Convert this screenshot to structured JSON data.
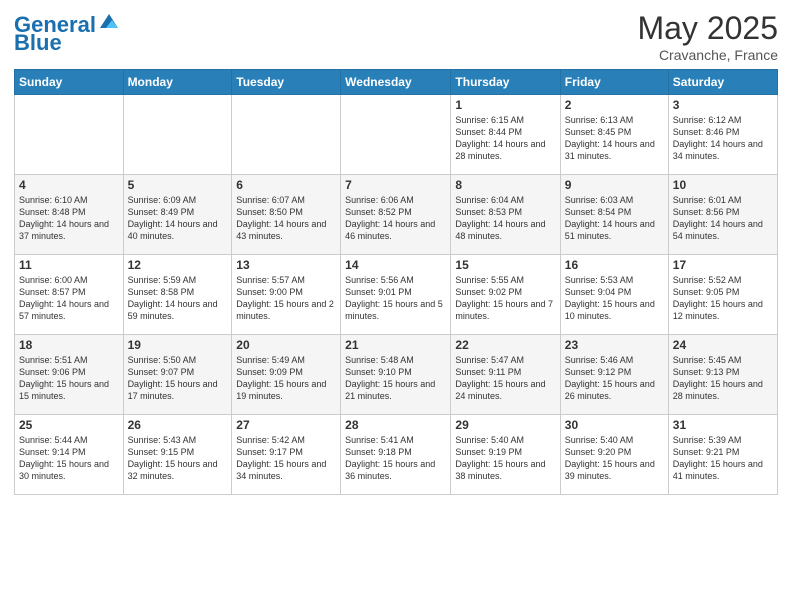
{
  "header": {
    "logo_general": "General",
    "logo_blue": "Blue",
    "month_year": "May 2025",
    "location": "Cravanche, France"
  },
  "weekdays": [
    "Sunday",
    "Monday",
    "Tuesday",
    "Wednesday",
    "Thursday",
    "Friday",
    "Saturday"
  ],
  "weeks": [
    [
      {
        "day": "",
        "info": ""
      },
      {
        "day": "",
        "info": ""
      },
      {
        "day": "",
        "info": ""
      },
      {
        "day": "",
        "info": ""
      },
      {
        "day": "1",
        "info": "Sunrise: 6:15 AM\nSunset: 8:44 PM\nDaylight: 14 hours and 28 minutes."
      },
      {
        "day": "2",
        "info": "Sunrise: 6:13 AM\nSunset: 8:45 PM\nDaylight: 14 hours and 31 minutes."
      },
      {
        "day": "3",
        "info": "Sunrise: 6:12 AM\nSunset: 8:46 PM\nDaylight: 14 hours and 34 minutes."
      }
    ],
    [
      {
        "day": "4",
        "info": "Sunrise: 6:10 AM\nSunset: 8:48 PM\nDaylight: 14 hours and 37 minutes."
      },
      {
        "day": "5",
        "info": "Sunrise: 6:09 AM\nSunset: 8:49 PM\nDaylight: 14 hours and 40 minutes."
      },
      {
        "day": "6",
        "info": "Sunrise: 6:07 AM\nSunset: 8:50 PM\nDaylight: 14 hours and 43 minutes."
      },
      {
        "day": "7",
        "info": "Sunrise: 6:06 AM\nSunset: 8:52 PM\nDaylight: 14 hours and 46 minutes."
      },
      {
        "day": "8",
        "info": "Sunrise: 6:04 AM\nSunset: 8:53 PM\nDaylight: 14 hours and 48 minutes."
      },
      {
        "day": "9",
        "info": "Sunrise: 6:03 AM\nSunset: 8:54 PM\nDaylight: 14 hours and 51 minutes."
      },
      {
        "day": "10",
        "info": "Sunrise: 6:01 AM\nSunset: 8:56 PM\nDaylight: 14 hours and 54 minutes."
      }
    ],
    [
      {
        "day": "11",
        "info": "Sunrise: 6:00 AM\nSunset: 8:57 PM\nDaylight: 14 hours and 57 minutes."
      },
      {
        "day": "12",
        "info": "Sunrise: 5:59 AM\nSunset: 8:58 PM\nDaylight: 14 hours and 59 minutes."
      },
      {
        "day": "13",
        "info": "Sunrise: 5:57 AM\nSunset: 9:00 PM\nDaylight: 15 hours and 2 minutes."
      },
      {
        "day": "14",
        "info": "Sunrise: 5:56 AM\nSunset: 9:01 PM\nDaylight: 15 hours and 5 minutes."
      },
      {
        "day": "15",
        "info": "Sunrise: 5:55 AM\nSunset: 9:02 PM\nDaylight: 15 hours and 7 minutes."
      },
      {
        "day": "16",
        "info": "Sunrise: 5:53 AM\nSunset: 9:04 PM\nDaylight: 15 hours and 10 minutes."
      },
      {
        "day": "17",
        "info": "Sunrise: 5:52 AM\nSunset: 9:05 PM\nDaylight: 15 hours and 12 minutes."
      }
    ],
    [
      {
        "day": "18",
        "info": "Sunrise: 5:51 AM\nSunset: 9:06 PM\nDaylight: 15 hours and 15 minutes."
      },
      {
        "day": "19",
        "info": "Sunrise: 5:50 AM\nSunset: 9:07 PM\nDaylight: 15 hours and 17 minutes."
      },
      {
        "day": "20",
        "info": "Sunrise: 5:49 AM\nSunset: 9:09 PM\nDaylight: 15 hours and 19 minutes."
      },
      {
        "day": "21",
        "info": "Sunrise: 5:48 AM\nSunset: 9:10 PM\nDaylight: 15 hours and 21 minutes."
      },
      {
        "day": "22",
        "info": "Sunrise: 5:47 AM\nSunset: 9:11 PM\nDaylight: 15 hours and 24 minutes."
      },
      {
        "day": "23",
        "info": "Sunrise: 5:46 AM\nSunset: 9:12 PM\nDaylight: 15 hours and 26 minutes."
      },
      {
        "day": "24",
        "info": "Sunrise: 5:45 AM\nSunset: 9:13 PM\nDaylight: 15 hours and 28 minutes."
      }
    ],
    [
      {
        "day": "25",
        "info": "Sunrise: 5:44 AM\nSunset: 9:14 PM\nDaylight: 15 hours and 30 minutes."
      },
      {
        "day": "26",
        "info": "Sunrise: 5:43 AM\nSunset: 9:15 PM\nDaylight: 15 hours and 32 minutes."
      },
      {
        "day": "27",
        "info": "Sunrise: 5:42 AM\nSunset: 9:17 PM\nDaylight: 15 hours and 34 minutes."
      },
      {
        "day": "28",
        "info": "Sunrise: 5:41 AM\nSunset: 9:18 PM\nDaylight: 15 hours and 36 minutes."
      },
      {
        "day": "29",
        "info": "Sunrise: 5:40 AM\nSunset: 9:19 PM\nDaylight: 15 hours and 38 minutes."
      },
      {
        "day": "30",
        "info": "Sunrise: 5:40 AM\nSunset: 9:20 PM\nDaylight: 15 hours and 39 minutes."
      },
      {
        "day": "31",
        "info": "Sunrise: 5:39 AM\nSunset: 9:21 PM\nDaylight: 15 hours and 41 minutes."
      }
    ]
  ]
}
